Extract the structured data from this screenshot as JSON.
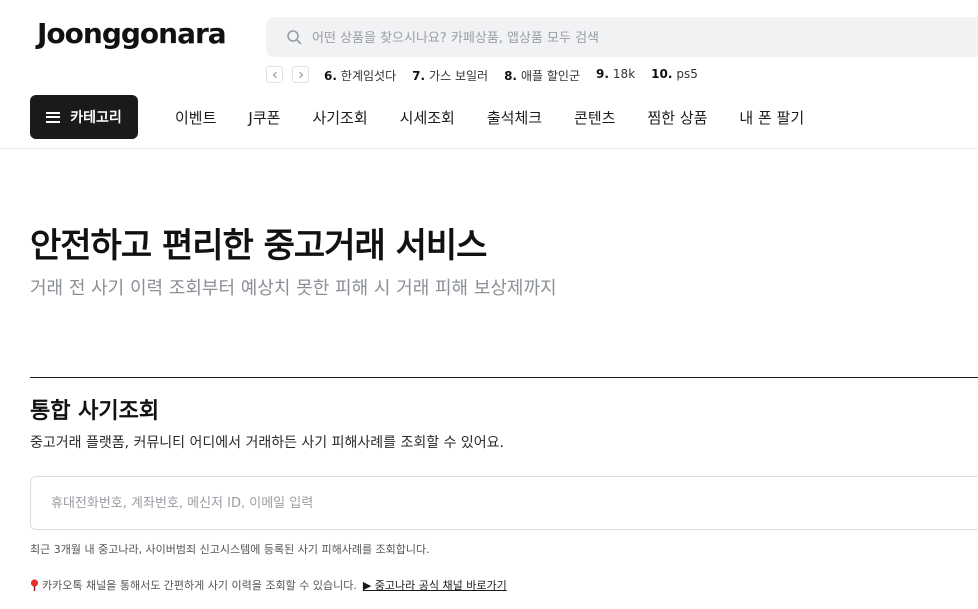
{
  "header": {
    "logo": "Joonggonara",
    "search_placeholder": "어떤 상품을 찾으시나요? 카페상품, 앱상품 모두 검색"
  },
  "popular_keywords": [
    {
      "rank": "6.",
      "label": "한계임섯다"
    },
    {
      "rank": "7.",
      "label": "가스 보일러"
    },
    {
      "rank": "8.",
      "label": "애플 할인군"
    },
    {
      "rank": "9.",
      "label": "18k"
    },
    {
      "rank": "10.",
      "label": "ps5"
    }
  ],
  "nav": {
    "category_label": "카테고리",
    "items": [
      "이벤트",
      "J쿠폰",
      "사기조회",
      "시세조회",
      "출석체크",
      "콘텐츠",
      "찜한 상품",
      "내 폰 팔기"
    ]
  },
  "hero": {
    "title": "안전하고 편리한 중고거래 서비스",
    "subtitle": "거래 전 사기 이력 조회부터 예상치 못한 피해 시 거래 피해 보상제까지"
  },
  "fraud_lookup": {
    "title": "통합 사기조회",
    "description": "중고거래 플랫폼, 커뮤니티 어디에서 거래하든 사기 피해사례를 조회할 수 있어요.",
    "input_placeholder": "휴대전화번호, 계좌번호, 메신저 ID, 이메일 입력",
    "note": "최근 3개월 내 중고나라, 사이버범죄 신고시스템에 등록된 사기 피해사례를 조회합니다.",
    "kakao_text": "카카오톡 채널을 통해서도 간편하게 사기 이력을 조회할 수 있습니다.",
    "kakao_link": "▶ 중고나라 공식 채널 바로가기"
  },
  "colors": {
    "accent_dark": "#1a1a1a",
    "search_bg": "#f1f2f4",
    "pin_red": "#e4322b"
  }
}
